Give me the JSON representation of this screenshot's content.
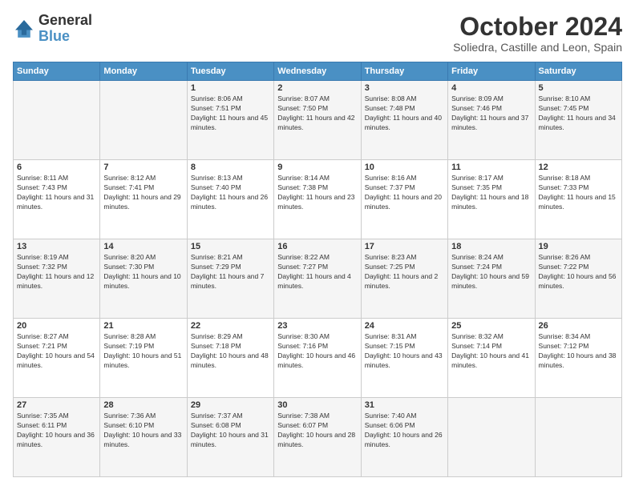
{
  "logo": {
    "line1": "General",
    "line2": "Blue"
  },
  "title": "October 2024",
  "subtitle": "Soliedra, Castille and Leon, Spain",
  "days_header": [
    "Sunday",
    "Monday",
    "Tuesday",
    "Wednesday",
    "Thursday",
    "Friday",
    "Saturday"
  ],
  "weeks": [
    [
      {
        "num": "",
        "info": ""
      },
      {
        "num": "",
        "info": ""
      },
      {
        "num": "1",
        "info": "Sunrise: 8:06 AM\nSunset: 7:51 PM\nDaylight: 11 hours and 45 minutes."
      },
      {
        "num": "2",
        "info": "Sunrise: 8:07 AM\nSunset: 7:50 PM\nDaylight: 11 hours and 42 minutes."
      },
      {
        "num": "3",
        "info": "Sunrise: 8:08 AM\nSunset: 7:48 PM\nDaylight: 11 hours and 40 minutes."
      },
      {
        "num": "4",
        "info": "Sunrise: 8:09 AM\nSunset: 7:46 PM\nDaylight: 11 hours and 37 minutes."
      },
      {
        "num": "5",
        "info": "Sunrise: 8:10 AM\nSunset: 7:45 PM\nDaylight: 11 hours and 34 minutes."
      }
    ],
    [
      {
        "num": "6",
        "info": "Sunrise: 8:11 AM\nSunset: 7:43 PM\nDaylight: 11 hours and 31 minutes."
      },
      {
        "num": "7",
        "info": "Sunrise: 8:12 AM\nSunset: 7:41 PM\nDaylight: 11 hours and 29 minutes."
      },
      {
        "num": "8",
        "info": "Sunrise: 8:13 AM\nSunset: 7:40 PM\nDaylight: 11 hours and 26 minutes."
      },
      {
        "num": "9",
        "info": "Sunrise: 8:14 AM\nSunset: 7:38 PM\nDaylight: 11 hours and 23 minutes."
      },
      {
        "num": "10",
        "info": "Sunrise: 8:16 AM\nSunset: 7:37 PM\nDaylight: 11 hours and 20 minutes."
      },
      {
        "num": "11",
        "info": "Sunrise: 8:17 AM\nSunset: 7:35 PM\nDaylight: 11 hours and 18 minutes."
      },
      {
        "num": "12",
        "info": "Sunrise: 8:18 AM\nSunset: 7:33 PM\nDaylight: 11 hours and 15 minutes."
      }
    ],
    [
      {
        "num": "13",
        "info": "Sunrise: 8:19 AM\nSunset: 7:32 PM\nDaylight: 11 hours and 12 minutes."
      },
      {
        "num": "14",
        "info": "Sunrise: 8:20 AM\nSunset: 7:30 PM\nDaylight: 11 hours and 10 minutes."
      },
      {
        "num": "15",
        "info": "Sunrise: 8:21 AM\nSunset: 7:29 PM\nDaylight: 11 hours and 7 minutes."
      },
      {
        "num": "16",
        "info": "Sunrise: 8:22 AM\nSunset: 7:27 PM\nDaylight: 11 hours and 4 minutes."
      },
      {
        "num": "17",
        "info": "Sunrise: 8:23 AM\nSunset: 7:25 PM\nDaylight: 11 hours and 2 minutes."
      },
      {
        "num": "18",
        "info": "Sunrise: 8:24 AM\nSunset: 7:24 PM\nDaylight: 10 hours and 59 minutes."
      },
      {
        "num": "19",
        "info": "Sunrise: 8:26 AM\nSunset: 7:22 PM\nDaylight: 10 hours and 56 minutes."
      }
    ],
    [
      {
        "num": "20",
        "info": "Sunrise: 8:27 AM\nSunset: 7:21 PM\nDaylight: 10 hours and 54 minutes."
      },
      {
        "num": "21",
        "info": "Sunrise: 8:28 AM\nSunset: 7:19 PM\nDaylight: 10 hours and 51 minutes."
      },
      {
        "num": "22",
        "info": "Sunrise: 8:29 AM\nSunset: 7:18 PM\nDaylight: 10 hours and 48 minutes."
      },
      {
        "num": "23",
        "info": "Sunrise: 8:30 AM\nSunset: 7:16 PM\nDaylight: 10 hours and 46 minutes."
      },
      {
        "num": "24",
        "info": "Sunrise: 8:31 AM\nSunset: 7:15 PM\nDaylight: 10 hours and 43 minutes."
      },
      {
        "num": "25",
        "info": "Sunrise: 8:32 AM\nSunset: 7:14 PM\nDaylight: 10 hours and 41 minutes."
      },
      {
        "num": "26",
        "info": "Sunrise: 8:34 AM\nSunset: 7:12 PM\nDaylight: 10 hours and 38 minutes."
      }
    ],
    [
      {
        "num": "27",
        "info": "Sunrise: 7:35 AM\nSunset: 6:11 PM\nDaylight: 10 hours and 36 minutes."
      },
      {
        "num": "28",
        "info": "Sunrise: 7:36 AM\nSunset: 6:10 PM\nDaylight: 10 hours and 33 minutes."
      },
      {
        "num": "29",
        "info": "Sunrise: 7:37 AM\nSunset: 6:08 PM\nDaylight: 10 hours and 31 minutes."
      },
      {
        "num": "30",
        "info": "Sunrise: 7:38 AM\nSunset: 6:07 PM\nDaylight: 10 hours and 28 minutes."
      },
      {
        "num": "31",
        "info": "Sunrise: 7:40 AM\nSunset: 6:06 PM\nDaylight: 10 hours and 26 minutes."
      },
      {
        "num": "",
        "info": ""
      },
      {
        "num": "",
        "info": ""
      }
    ]
  ]
}
